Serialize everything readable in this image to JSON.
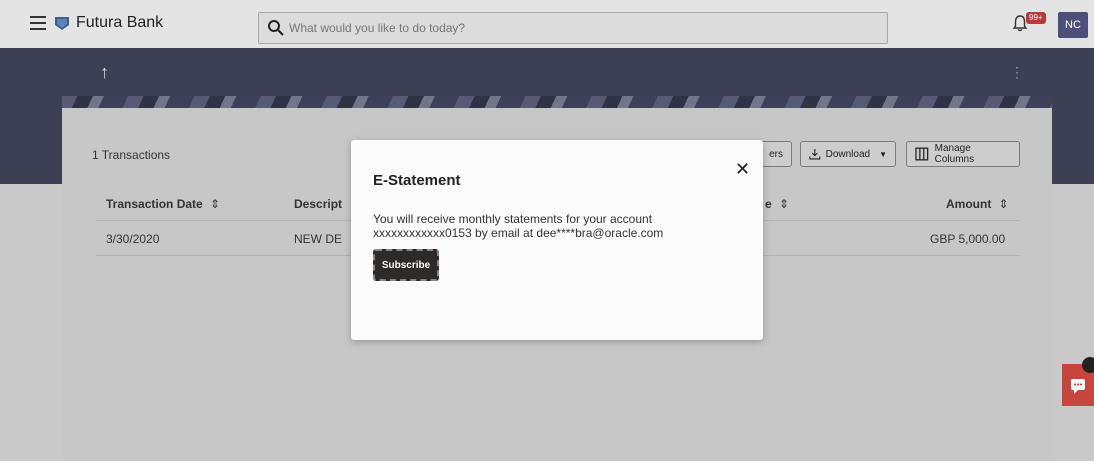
{
  "header": {
    "brand_name": "Futura Bank",
    "search_placeholder": "What would you like to do today?",
    "notification_badge": "99+",
    "avatar_initials": "NC"
  },
  "page": {
    "back_icon": "up-arrow-icon",
    "more_icon": "kebab-icon"
  },
  "transactions": {
    "count_label": "1 Transactions",
    "filters_label": "ers",
    "download_label": "Download",
    "manage_columns_label": "Manage Columns",
    "columns": [
      "Transaction Date",
      "Descript",
      "e",
      "Amount"
    ],
    "rows": [
      {
        "date": "3/30/2020",
        "description": "NEW DE",
        "amount": "GBP 5,000.00"
      }
    ]
  },
  "modal": {
    "title": "E-Statement",
    "message_line1": "You will receive monthly statements for your account",
    "message_line2": "xxxxxxxxxxxx0153 by email at dee****bra@oracle.com",
    "subscribe_label": "Subscribe",
    "close_symbol": "✕"
  },
  "colors": {
    "accent": "#4e4f78",
    "band": "#3d3f55",
    "badge": "#b8393c",
    "chat": "#c6463e"
  }
}
